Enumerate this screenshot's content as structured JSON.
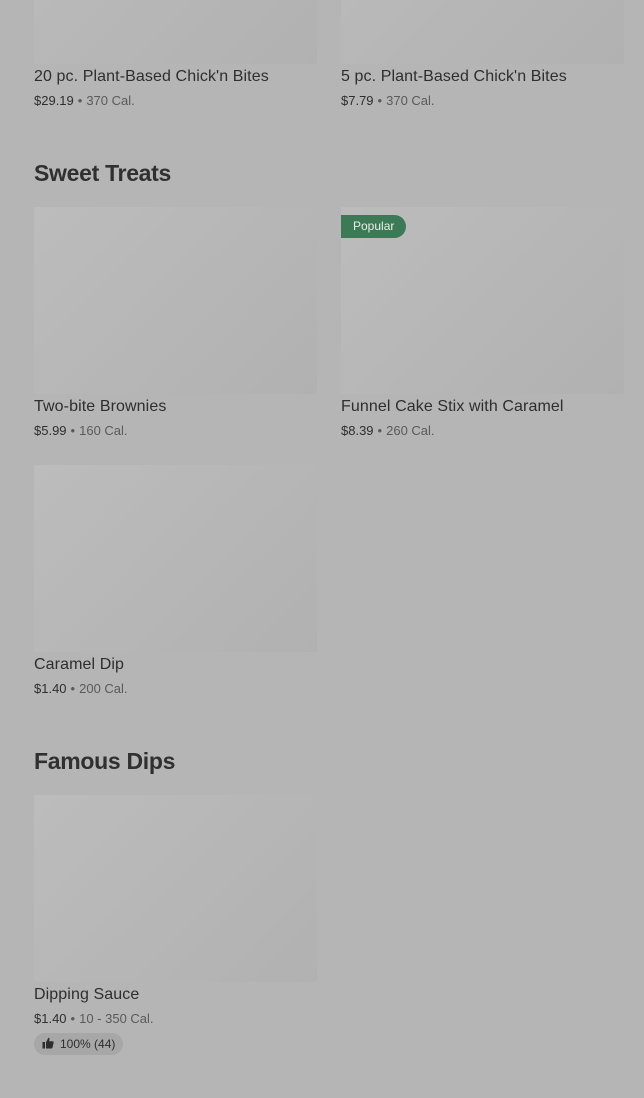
{
  "sections": {
    "sweet_treats": {
      "title": "Sweet Treats"
    },
    "famous_dips": {
      "title": "Famous Dips"
    }
  },
  "items": {
    "bites20": {
      "name": "20 pc. Plant-Based Chick'n Bites",
      "price": "$29.19",
      "cal": "370 Cal."
    },
    "bites5": {
      "name": "5 pc. Plant-Based Chick'n Bites",
      "price": "$7.79",
      "cal": "370 Cal."
    },
    "brownies": {
      "name": "Two-bite Brownies",
      "price": "$5.99",
      "cal": "160 Cal."
    },
    "funnel": {
      "name": "Funnel Cake Stix with Caramel",
      "price": "$8.39",
      "cal": "260 Cal.",
      "badge": "Popular"
    },
    "caramel": {
      "name": "Caramel Dip",
      "price": "$1.40",
      "cal": "200 Cal."
    },
    "sauce": {
      "name": "Dipping Sauce",
      "price": "$1.40",
      "cal": "10 - 350 Cal.",
      "rating": "100% (44)"
    }
  },
  "separator": "•",
  "icons": {
    "rating": "thumbs-up-icon"
  },
  "colors": {
    "badge": "#3c7a55",
    "overlay": "#b5b5b5"
  }
}
